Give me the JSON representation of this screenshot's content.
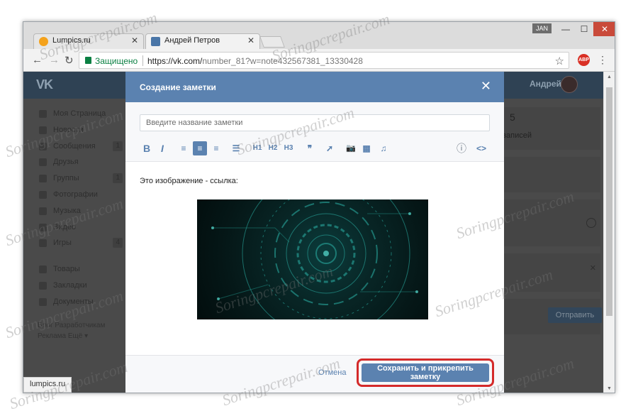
{
  "browser": {
    "user_chip": "JAN",
    "tabs": [
      {
        "title": "Lumpics.ru",
        "close": "✕",
        "favicon_color": "#f4a21c"
      },
      {
        "title": "Андрей Петров",
        "close": "✕",
        "favicon_color": "#4a76a8"
      }
    ],
    "controls": {
      "minimize": "—",
      "maximize": "☐",
      "close": "✕"
    },
    "nav": {
      "back": "←",
      "forward": "→",
      "reload": "↻"
    },
    "secure_label": "Защищено",
    "url_main": "https://vk.com/",
    "url_rest": "number_81?w=note432567381_13330428",
    "bookmark": "☆",
    "ext_badge": "ABP",
    "menu": "⋮",
    "status_text": "lumpics.ru"
  },
  "vk": {
    "logo": "VK",
    "user_name": "Андрей",
    "sidebar": [
      {
        "label": "Моя Страница",
        "count": ""
      },
      {
        "label": "Новости",
        "count": ""
      },
      {
        "label": "Сообщения",
        "count": "1"
      },
      {
        "label": "Друзья",
        "count": ""
      },
      {
        "label": "Группы",
        "count": "1"
      },
      {
        "label": "Фотографии",
        "count": ""
      },
      {
        "label": "Музыка",
        "count": ""
      },
      {
        "label": "Видео",
        "count": ""
      },
      {
        "label": "Игры",
        "count": "4"
      }
    ],
    "sidebar2": [
      {
        "label": "Товары"
      },
      {
        "label": "Закладки"
      },
      {
        "label": "Документы"
      }
    ],
    "footer_line1": "Блог   Разработчикам",
    "footer_line2": "Реклама   Ещё ▾",
    "right_count": "5",
    "right_label": "записей",
    "send_button": "Отправить"
  },
  "modal": {
    "title": "Создание заметки",
    "close": "✕",
    "title_placeholder": "Введите название заметки",
    "toolbar": [
      "B",
      "I",
      "≡",
      "≡",
      "≡",
      "☰",
      "H1",
      "H2",
      "H3",
      "❞",
      "➚",
      "📷",
      "▦",
      "♫",
      "ⓘ",
      "<>"
    ],
    "body_text": "Это изображение - ссылка:",
    "cancel": "Отмена",
    "save": "Сохранить и прикрепить заметку"
  },
  "watermark": "Soringpcrepair.com"
}
